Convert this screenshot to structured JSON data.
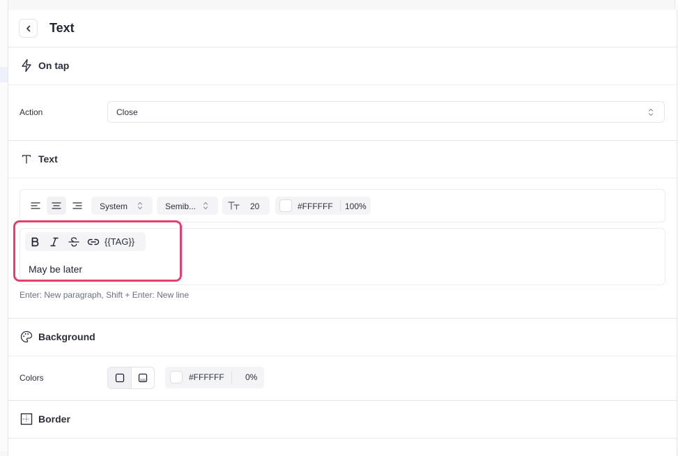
{
  "header": {
    "title": "Text",
    "back_icon": "chevron-left-icon"
  },
  "on_tap": {
    "title": "On tap",
    "icon": "lightning-icon",
    "action_label": "Action",
    "action_value": "Close"
  },
  "text_section": {
    "title": "Text",
    "icon": "text-t-icon",
    "toolbar": {
      "align_buttons": [
        "align-left",
        "align-center",
        "align-right"
      ],
      "active_align": "align-center",
      "font_family": "System",
      "font_weight": "Semib...",
      "font_size": "20",
      "color_hex": "#FFFFFF",
      "opacity": "100%"
    },
    "format_buttons": [
      "bold",
      "italic",
      "strikethrough",
      "link"
    ],
    "tag_label": "{{TAG}}",
    "content": "May be later",
    "hint": "Enter: New paragraph, Shift + Enter: New line"
  },
  "background": {
    "title": "Background",
    "icon": "palette-icon",
    "colors_label": "Colors",
    "color_hex": "#FFFFFF",
    "opacity": "0%"
  },
  "border": {
    "title": "Border",
    "icon": "border-icon"
  },
  "colors": {
    "highlight": "#e63e6d",
    "swatch": "#FFFFFF"
  }
}
